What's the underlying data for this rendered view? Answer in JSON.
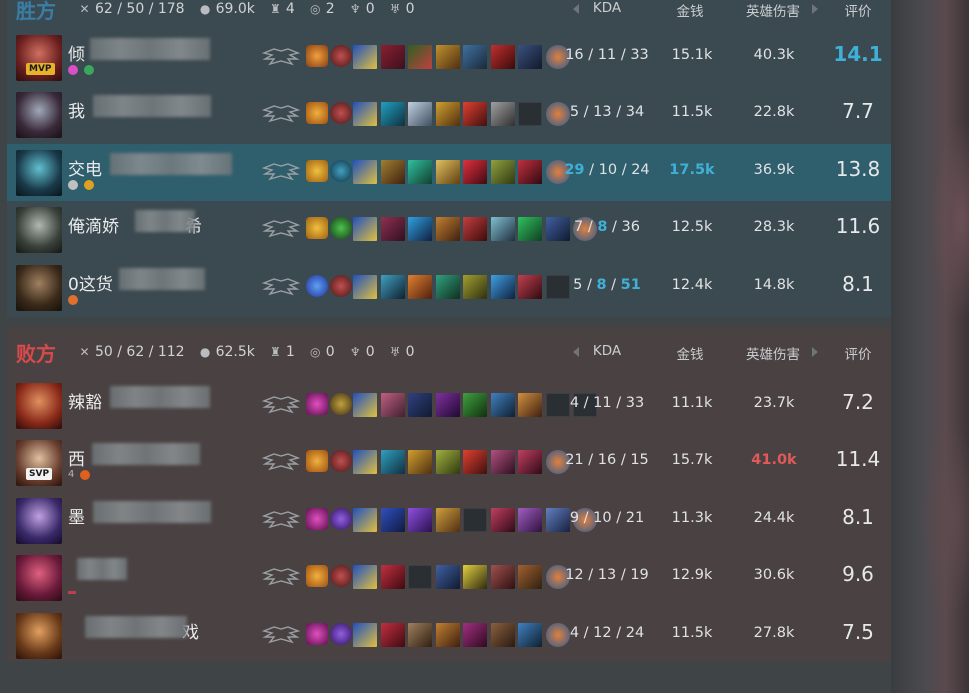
{
  "winning_team": {
    "name": "胜方",
    "kills_summary": "62 / 50 / 178",
    "gold": "69.0k",
    "towers": "4",
    "dragons": "2",
    "barons": "0",
    "heralds": "0",
    "columns": {
      "kda": "KDA",
      "gold": "金钱",
      "damage": "英雄伤害",
      "score": "评价"
    },
    "players": [
      {
        "name": "倾",
        "kda_k": "16",
        "kda_d": "11",
        "kda_a": "33",
        "gold": "15.1k",
        "damage": "40.3k",
        "score": "14.1",
        "badge": "MVP"
      },
      {
        "name": "我",
        "kda_k": "5",
        "kda_d": "13",
        "kda_a": "34",
        "gold": "11.5k",
        "damage": "22.8k",
        "score": "7.7"
      },
      {
        "name": "交电",
        "kda_k": "29",
        "kda_d": "10",
        "kda_a": "24",
        "gold": "17.5k",
        "damage": "36.9k",
        "score": "13.8"
      },
      {
        "name": "俺滴娇",
        "name_suffix": "希",
        "kda_k": "7",
        "kda_d": "8",
        "kda_a": "36",
        "gold": "12.5k",
        "damage": "28.3k",
        "score": "11.6"
      },
      {
        "name": "0这货",
        "kda_k": "5",
        "kda_d": "8",
        "kda_a": "51",
        "gold": "12.4k",
        "damage": "14.8k",
        "score": "8.1"
      }
    ]
  },
  "losing_team": {
    "name": "败方",
    "kills_summary": "50 / 62 / 112",
    "gold": "62.5k",
    "towers": "1",
    "dragons": "0",
    "barons": "0",
    "heralds": "0",
    "columns": {
      "kda": "KDA",
      "gold": "金钱",
      "damage": "英雄伤害",
      "score": "评价"
    },
    "players": [
      {
        "name": "辣豁",
        "kda_k": "4",
        "kda_d": "11",
        "kda_a": "33",
        "gold": "11.1k",
        "damage": "23.7k",
        "score": "7.2"
      },
      {
        "name": "西",
        "kda_k": "21",
        "kda_d": "16",
        "kda_a": "15",
        "gold": "15.7k",
        "damage": "41.0k",
        "score": "11.4",
        "badge": "SVP",
        "extra": "4"
      },
      {
        "name": "墨",
        "kda_k": "9",
        "kda_d": "10",
        "kda_a": "21",
        "gold": "11.3k",
        "damage": "24.4k",
        "score": "8.1"
      },
      {
        "name": "",
        "kda_k": "12",
        "kda_d": "13",
        "kda_a": "19",
        "gold": "12.9k",
        "damage": "30.6k",
        "score": "9.6"
      },
      {
        "name": "",
        "name_suffix": "戏",
        "kda_k": "4",
        "kda_d": "12",
        "kda_a": "24",
        "gold": "11.5k",
        "damage": "27.8k",
        "score": "7.5"
      }
    ]
  },
  "colors": {
    "accent": "#3fb0d8",
    "win": "#3a7ea8",
    "lose": "#d84b4b",
    "highlight_row": "#2f5e6c"
  },
  "icons": [
    "sword-icon",
    "coin-icon",
    "tower-icon",
    "dragon-icon",
    "baron-icon",
    "herald-icon",
    "rank-wings-icon",
    "arrow-left-icon",
    "arrow-right-icon"
  ]
}
